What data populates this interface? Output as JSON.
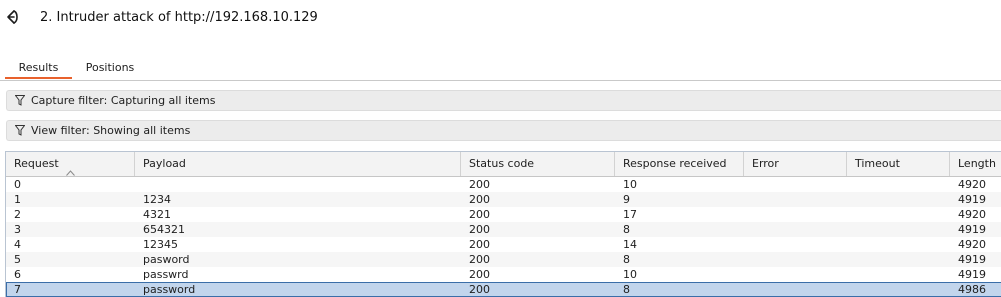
{
  "title": "2. Intruder attack of http://192.168.10.129",
  "tabs": [
    {
      "label": "Results",
      "active": true
    },
    {
      "label": "Positions",
      "active": false
    }
  ],
  "filters": {
    "capture": "Capture filter: Capturing all items",
    "view": "View filter: Showing all items"
  },
  "table": {
    "columns": [
      "Request",
      "Payload",
      "Status code",
      "Response received",
      "Error",
      "Timeout",
      "Length"
    ],
    "sorted_column": "Request",
    "rows": [
      {
        "request": "0",
        "payload": "",
        "status": "200",
        "response_received": "10",
        "error": "",
        "timeout": "",
        "length": "4920"
      },
      {
        "request": "1",
        "payload": "1234",
        "status": "200",
        "response_received": "9",
        "error": "",
        "timeout": "",
        "length": "4919"
      },
      {
        "request": "2",
        "payload": "4321",
        "status": "200",
        "response_received": "17",
        "error": "",
        "timeout": "",
        "length": "4920"
      },
      {
        "request": "3",
        "payload": "654321",
        "status": "200",
        "response_received": "8",
        "error": "",
        "timeout": "",
        "length": "4919"
      },
      {
        "request": "4",
        "payload": "12345",
        "status": "200",
        "response_received": "14",
        "error": "",
        "timeout": "",
        "length": "4920"
      },
      {
        "request": "5",
        "payload": "pasword",
        "status": "200",
        "response_received": "8",
        "error": "",
        "timeout": "",
        "length": "4919"
      },
      {
        "request": "6",
        "payload": "passwrd",
        "status": "200",
        "response_received": "10",
        "error": "",
        "timeout": "",
        "length": "4919"
      },
      {
        "request": "7",
        "payload": "password",
        "status": "200",
        "response_received": "8",
        "error": "",
        "timeout": "",
        "length": "4986"
      }
    ],
    "selected_row": 7
  },
  "icons": {
    "back": "back-arrow-icon",
    "filter": "funnel-icon",
    "sort": "sort-ascending-icon"
  },
  "colors": {
    "active_tab_underline": "#e8612c",
    "selected_row_bg": "#c2d5ec",
    "selected_row_border": "#3b6ea8"
  }
}
